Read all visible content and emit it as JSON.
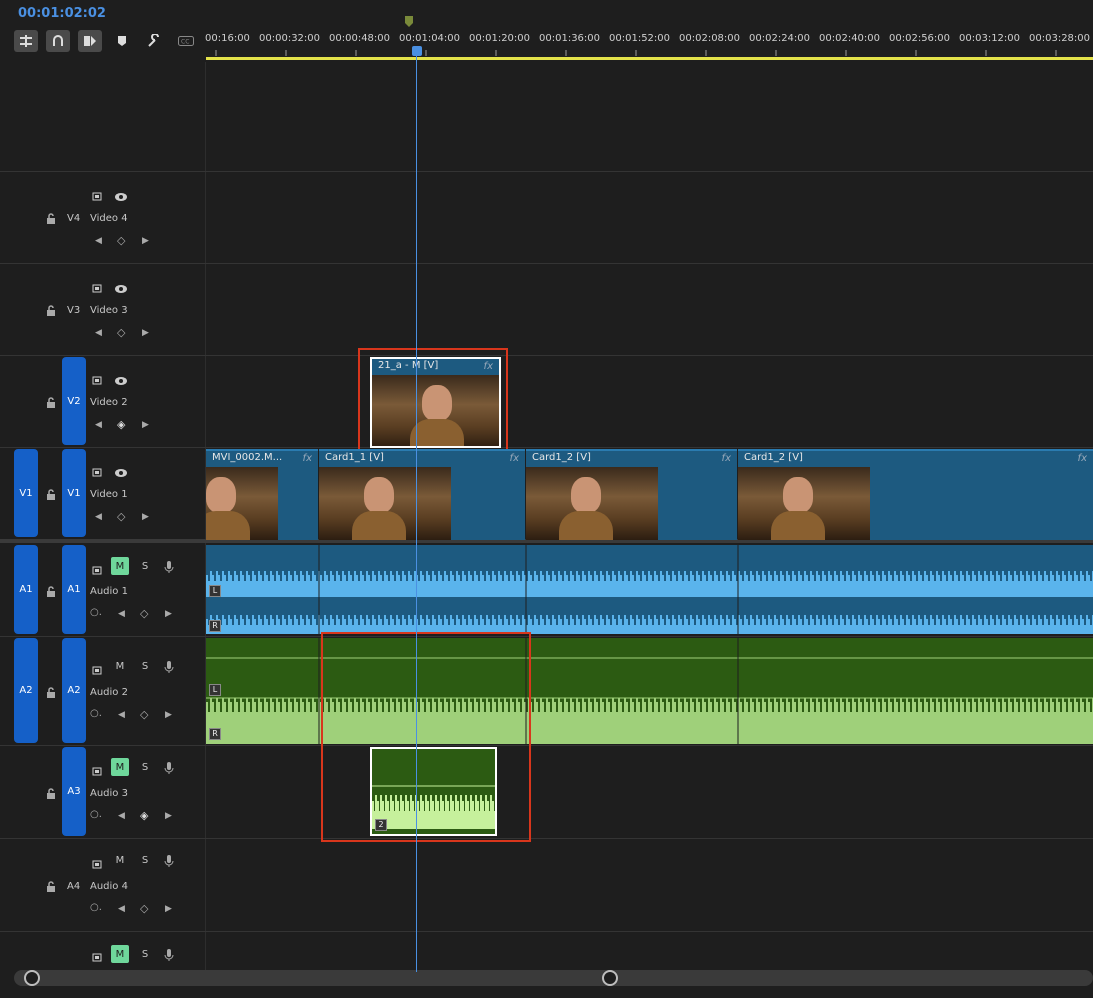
{
  "timecode": "00:01:02:02",
  "ruler": {
    "labels": [
      "00:16:00",
      "00:00:32:00",
      "00:00:48:00",
      "00:01:04:00",
      "00:01:20:00",
      "00:01:36:00",
      "00:01:52:00",
      "00:02:08:00",
      "00:02:24:00",
      "00:02:40:00",
      "00:02:56:00",
      "00:03:12:00",
      "00:03:28:00"
    ]
  },
  "tracks": {
    "v4": {
      "id": "V4",
      "name": "Video 4"
    },
    "v3": {
      "id": "V3",
      "name": "Video 3"
    },
    "v2": {
      "id": "V2",
      "name": "Video 2"
    },
    "v1": {
      "id": "V1",
      "name": "Video 1",
      "source": "V1"
    },
    "a1": {
      "id": "A1",
      "name": "Audio 1",
      "source": "A1",
      "m": "M",
      "s": "S"
    },
    "a2": {
      "id": "A2",
      "name": "Audio 2",
      "source": "A2",
      "m": "M",
      "s": "S"
    },
    "a3": {
      "id": "A3",
      "name": "Audio 3",
      "m": "M",
      "s": "S"
    },
    "a4": {
      "id": "A4",
      "name": "Audio 4",
      "m": "M",
      "s": "S"
    },
    "a5": {
      "m": "M",
      "s": "S"
    }
  },
  "clips": {
    "v2_clip": {
      "name": "21_a - M [V]",
      "fx": "fx"
    },
    "v1_clips": [
      {
        "name": "MVI_0002.M...",
        "fx": "fx"
      },
      {
        "name": "Card1_1 [V]",
        "fx": "fx"
      },
      {
        "name": "Card1_2 [V]",
        "fx": "fx"
      },
      {
        "name": "Card1_2 [V]",
        "fx": "fx"
      }
    ],
    "channel_l": "L",
    "channel_r": "R",
    "a3_badge": "2"
  },
  "colors": {
    "accent": "#4a90e2",
    "video_clip": "#1d5a80",
    "audio_blue": "#5ab4ec",
    "audio_green": "#2c5b12",
    "wave_green": "#9fd07a",
    "highlight": "#d8361c",
    "track_target": "#1560c8",
    "mute_on": "#6fd79b"
  }
}
